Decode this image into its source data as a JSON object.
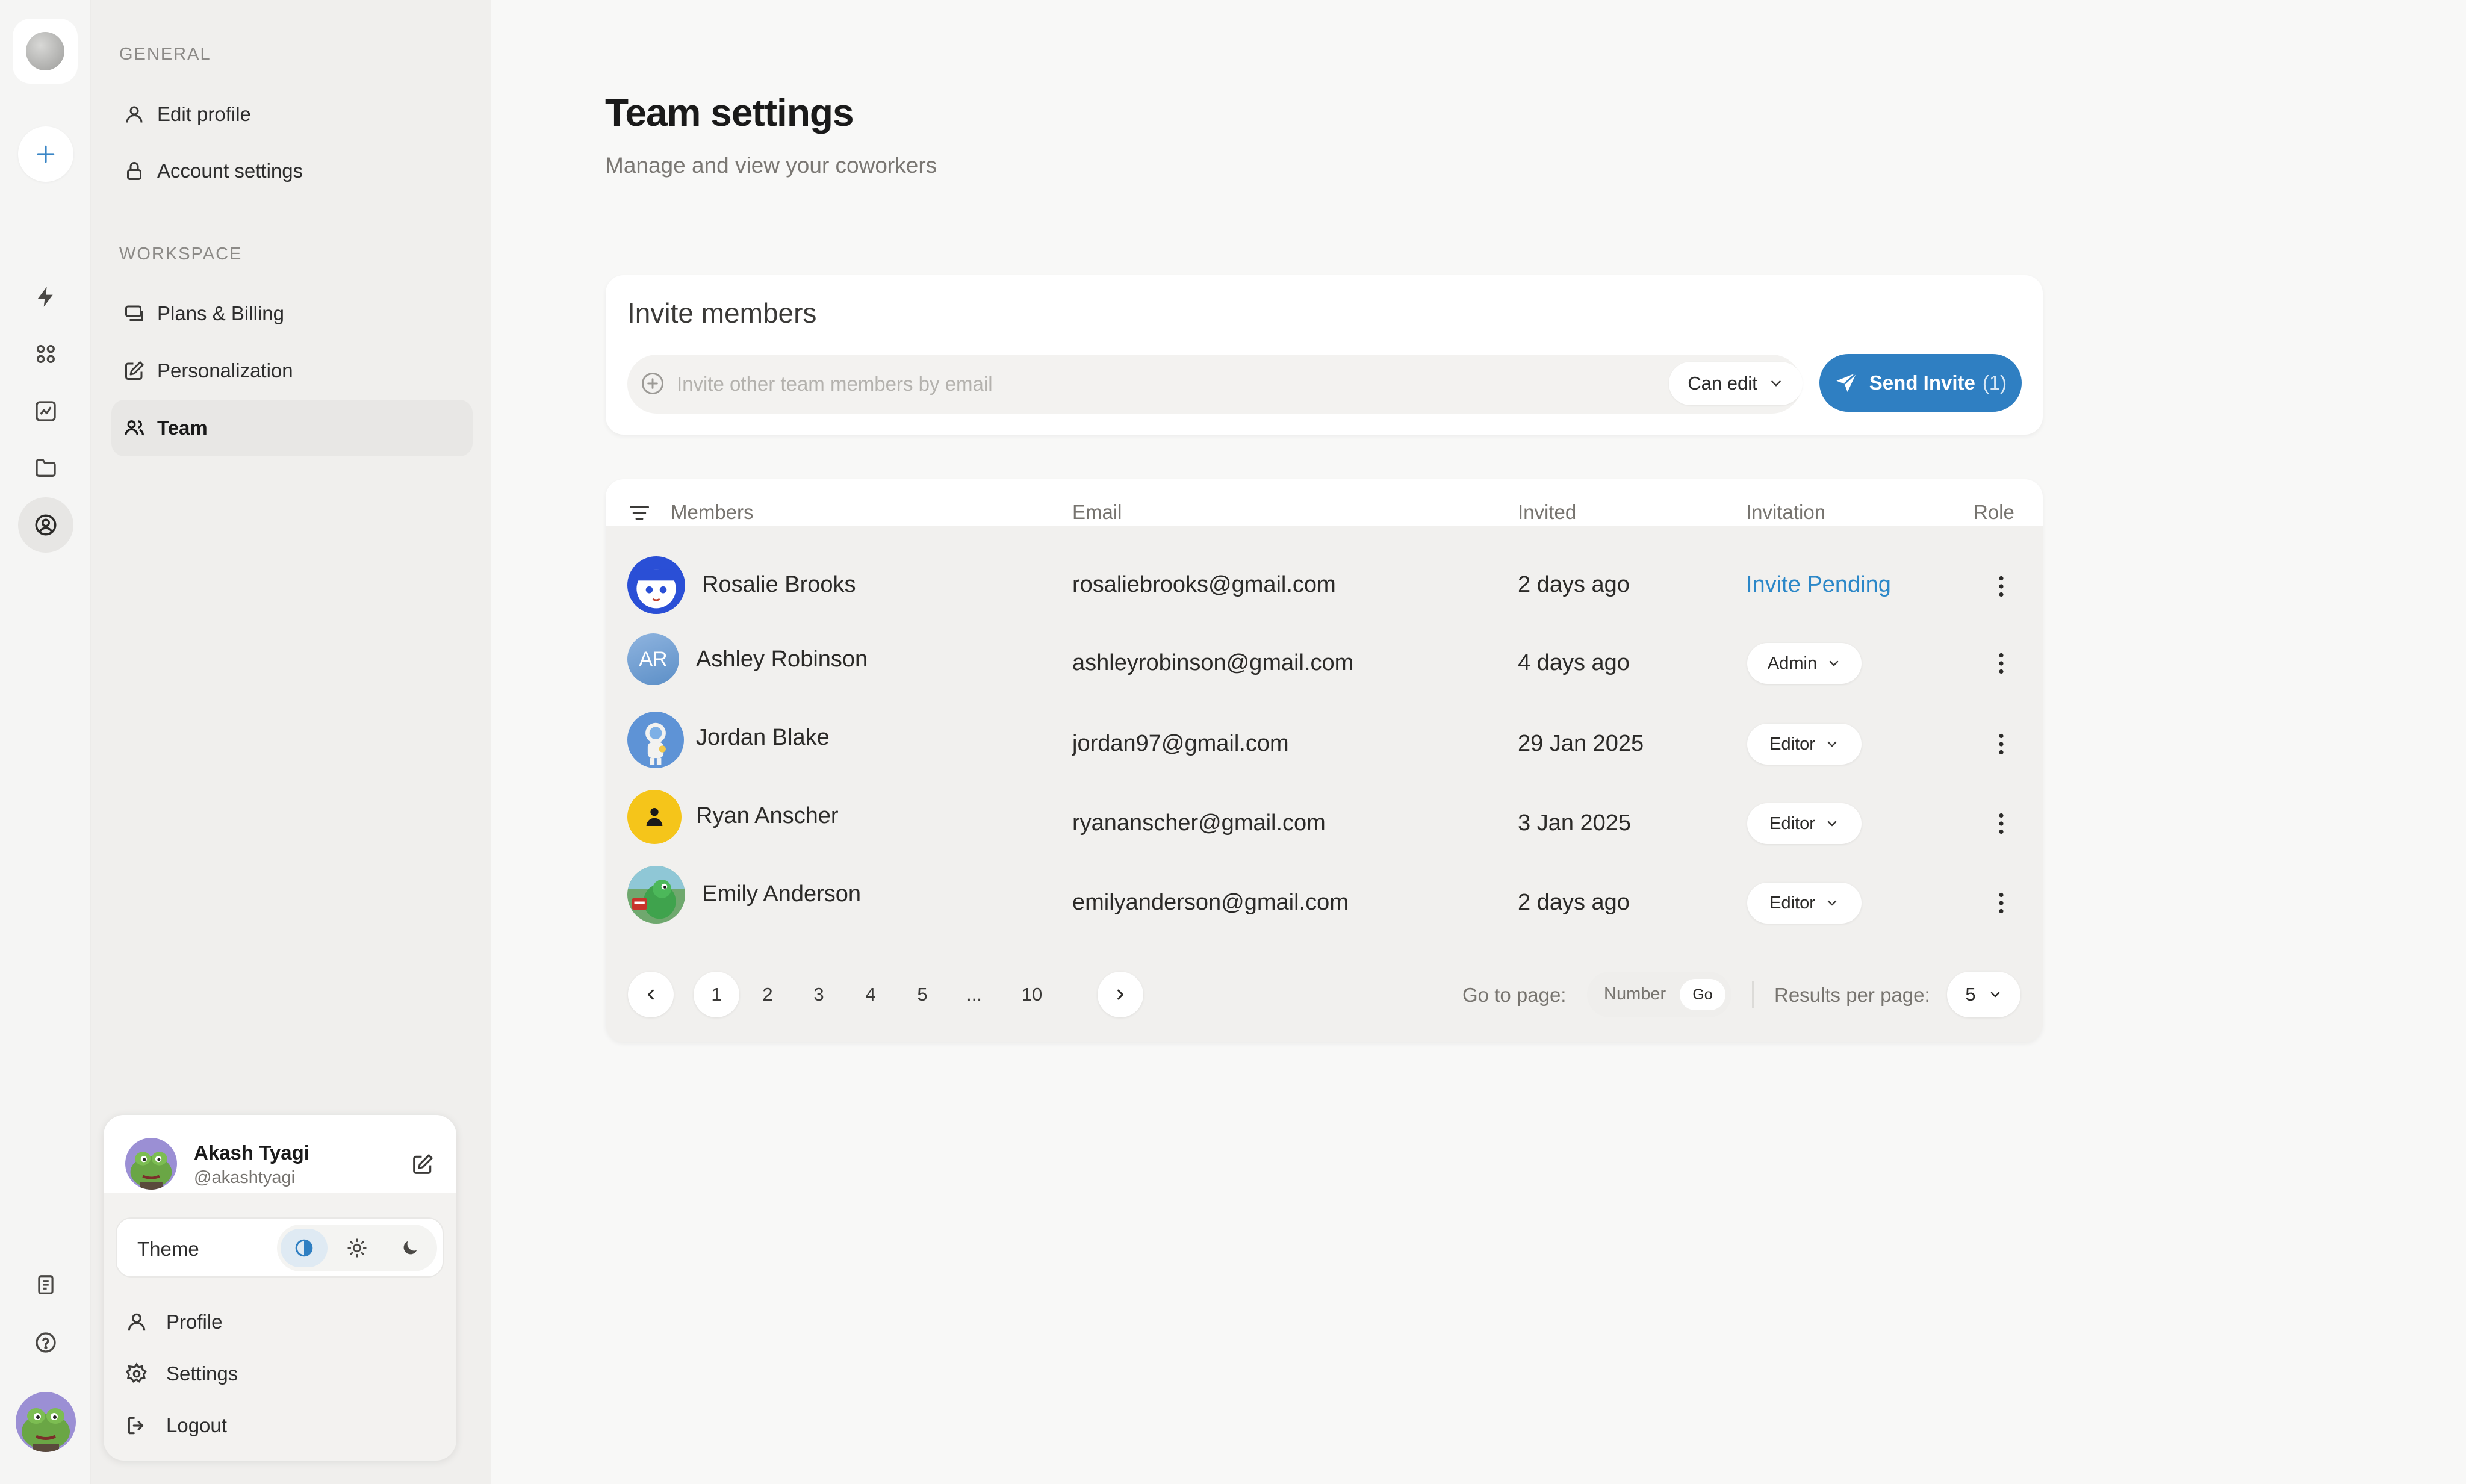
{
  "sidebar": {
    "general_label": "GENERAL",
    "workspace_label": "WORKSPACE",
    "items": [
      {
        "label": "Edit profile"
      },
      {
        "label": "Account settings"
      },
      {
        "label": "Plans & Billing"
      },
      {
        "label": "Personalization"
      },
      {
        "label": "Team"
      }
    ]
  },
  "user": {
    "name": "Akash Tyagi",
    "handle": "@akashtyagi",
    "theme_label": "Theme",
    "menu": [
      {
        "label": "Profile"
      },
      {
        "label": "Settings"
      },
      {
        "label": "Logout"
      }
    ]
  },
  "page": {
    "title": "Team settings",
    "subtitle": "Manage and view your coworkers"
  },
  "invite": {
    "title": "Invite members",
    "placeholder": "Invite other team members by email",
    "permission": "Can edit",
    "send_label": "Send Invite",
    "send_count": "(1)"
  },
  "table": {
    "columns": {
      "members": "Members",
      "email": "Email",
      "invited": "Invited",
      "invitation": "Invitation",
      "role": "Role"
    },
    "rows": [
      {
        "name": "Rosalie Brooks",
        "email": "rosaliebrooks@gmail.com",
        "invited": "2 days ago",
        "status": "Invite Pending",
        "avatar": "anime-avatar"
      },
      {
        "name": "Ashley Robinson",
        "email": "ashleyrobinson@gmail.com",
        "invited": "4 days ago",
        "role": "Admin",
        "initials": "AR"
      },
      {
        "name": "Jordan Blake",
        "email": "jordan97@gmail.com",
        "invited": "29 Jan 2025",
        "role": "Editor",
        "avatar": "astronaut-avatar"
      },
      {
        "name": "Ryan Anscher",
        "email": "ryananscher@gmail.com",
        "invited": "3 Jan 2025",
        "role": "Editor",
        "avatar": "person-icon"
      },
      {
        "name": "Emily Anderson",
        "email": "emilyanderson@gmail.com",
        "invited": "2 days ago",
        "role": "Editor",
        "avatar": "dino-avatar"
      }
    ]
  },
  "pagination": {
    "pages": [
      "1",
      "2",
      "3",
      "4",
      "5",
      "...",
      "10"
    ],
    "current": "1",
    "goto_label": "Go to page:",
    "number_placeholder": "Number",
    "go_label": "Go",
    "results_label": "Results per page:",
    "results_value": "5"
  },
  "colors": {
    "accent": "#2f7fc2",
    "pending": "#2b87c8",
    "background": "#f8f8f7",
    "sidebar": "#f0efed"
  }
}
